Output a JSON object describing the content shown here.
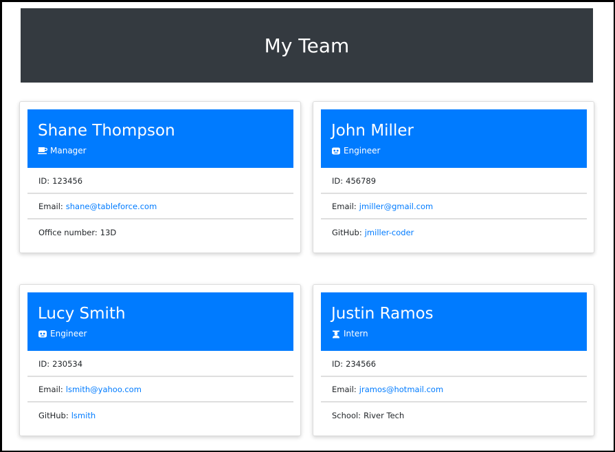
{
  "page": {
    "title": "My Team"
  },
  "colors": {
    "header_bg": "#343a40",
    "card_header_bg": "#007bff",
    "link": "#007bff"
  },
  "team": [
    {
      "name": "Shane Thompson",
      "role": "Manager",
      "role_icon": "coffee-mug-icon",
      "id_label": "ID:",
      "id": "123456",
      "email_label": "Email:",
      "email": "shane@tableforce.com",
      "extra_label": "Office number:",
      "extra": "13D"
    },
    {
      "name": "John Miller",
      "role": "Engineer",
      "role_icon": "robot-icon",
      "id_label": "ID:",
      "id": "456789",
      "email_label": "Email:",
      "email": "jmiller@gmail.com",
      "extra_label": "GitHub:",
      "extra": "jmiller-coder"
    },
    {
      "name": "Lucy Smith",
      "role": "Engineer",
      "role_icon": "robot-icon",
      "id_label": "ID:",
      "id": "230534",
      "email_label": "Email:",
      "email": "lsmith@yahoo.com",
      "extra_label": "GitHub:",
      "extra": "lsmith"
    },
    {
      "name": "Justin Ramos",
      "role": "Intern",
      "role_icon": "graduate-icon",
      "id_label": "ID:",
      "id": "234566",
      "email_label": "Email:",
      "email": "jramos@hotmail.com",
      "extra_label": "School:",
      "extra": "River Tech"
    }
  ]
}
